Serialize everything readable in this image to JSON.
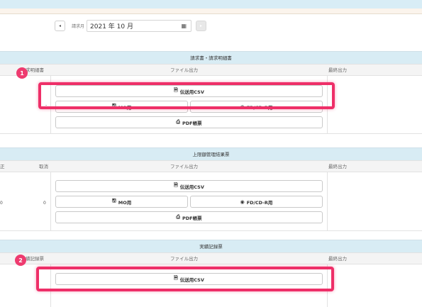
{
  "month_nav": {
    "prev_icon": "◂",
    "label": "請求月",
    "value": "2021 年 10 月",
    "calendar_icon": "calendar-icon",
    "next_icon": "▸"
  },
  "section1": {
    "title": "請求書・請求明細書",
    "col_left": "求明細書",
    "col_file": "ファイル出力",
    "col_last": "最終出力",
    "row_mark": "-",
    "btn_csv": "伝送用CSV",
    "btn_mo": "MO用",
    "btn_fd": "FD/CD-R用",
    "btn_pdf": "PDF帳票",
    "badge": "1"
  },
  "section2": {
    "title": "上限額管理結果票",
    "col_left1": "正",
    "col_left2": "取消",
    "col_file": "ファイル出力",
    "col_last": "最終出力",
    "val_left1": "0",
    "val_left2": "0",
    "btn_csv": "伝送用CSV",
    "btn_mo": "MO用",
    "btn_fd": "FD/CD-R用",
    "btn_pdf": "PDF帳票"
  },
  "section3": {
    "title": "実績記録票",
    "col_left": "績記録票",
    "col_file": "ファイル出力",
    "col_last": "最終出力",
    "btn_csv": "伝送用CSV",
    "badge": "2"
  }
}
